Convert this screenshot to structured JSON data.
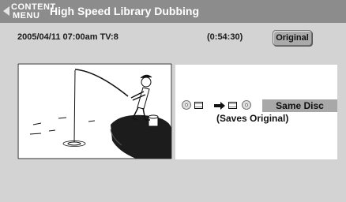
{
  "header": {
    "menu_line1": "CONTENT",
    "menu_line2": "MENU",
    "title": "High Speed Library Dubbing"
  },
  "info": {
    "datetime": "2005/04/11  07:00am  TV:8",
    "duration": "(0:54:30)",
    "original_button": "Original"
  },
  "dubbing": {
    "mode_label": "Same Disc",
    "mode_sub": "(Saves Original)"
  },
  "colors": {
    "header_bg": "#8c8c8c",
    "body_bg": "#d3d3d3",
    "panel_bg": "#ffffff",
    "label_bg": "#a8a8a8"
  },
  "icons": {
    "menu": "back-triangle-icon",
    "thumbnail": "fisherman-illustration",
    "source_disc": "disc-icon",
    "source_title": "film-frame-icon",
    "direction": "right-arrow-icon",
    "dest_title": "film-frame-icon",
    "dest_disc": "disc-icon"
  }
}
